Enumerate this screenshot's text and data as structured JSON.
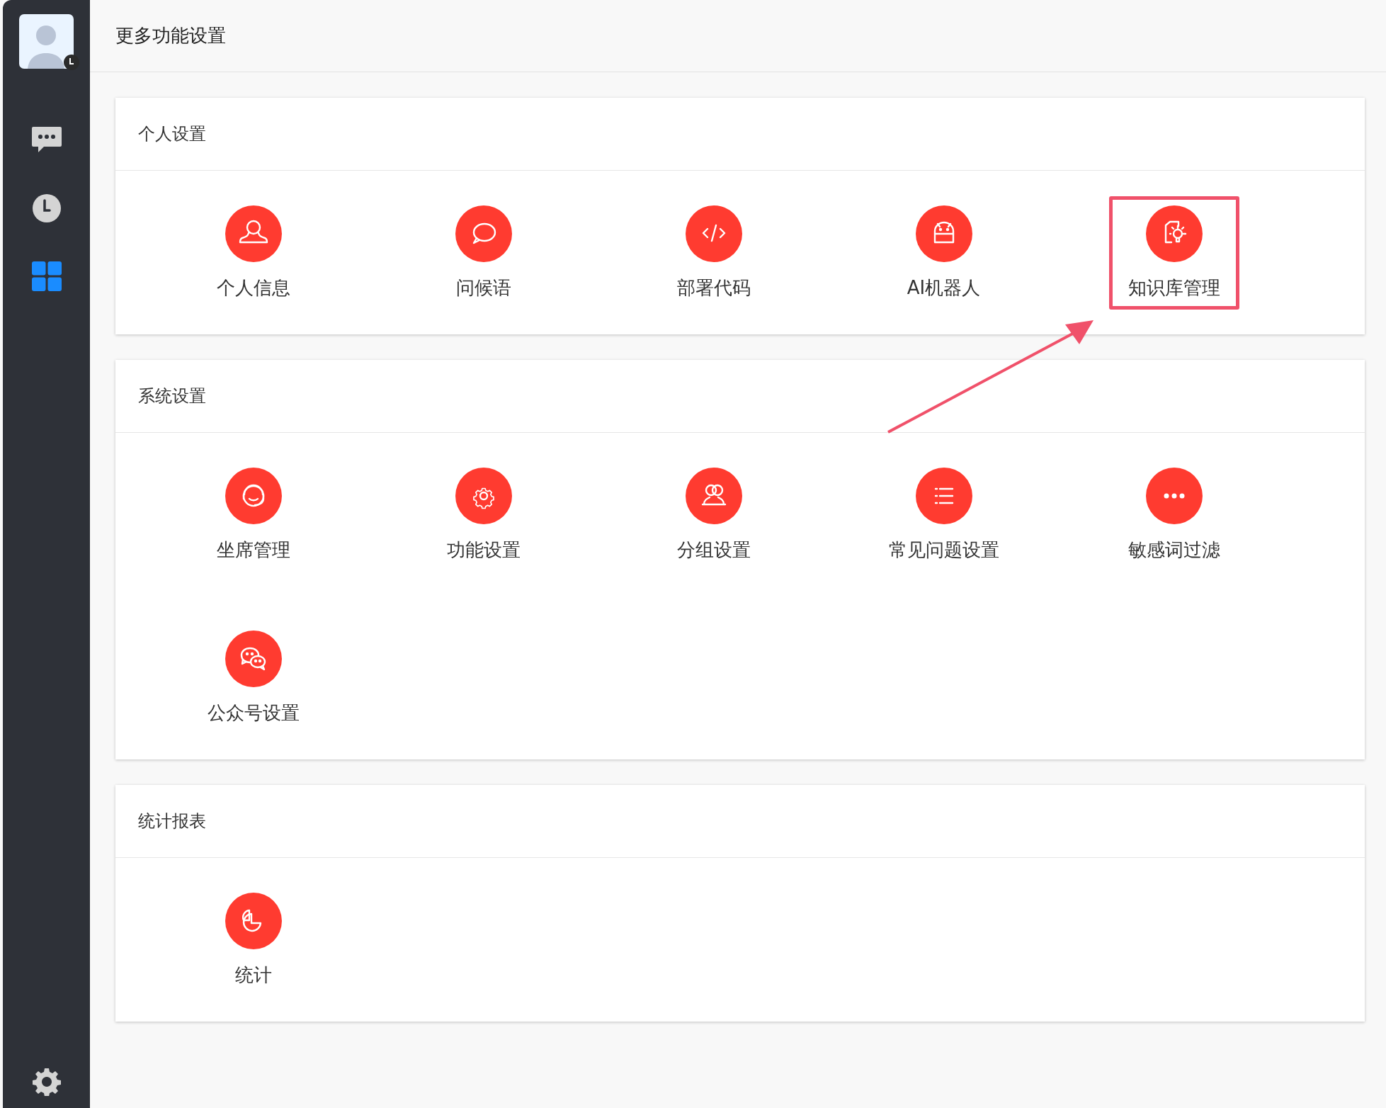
{
  "sidebar": {
    "items": [
      {
        "selected": false
      },
      {
        "selected": false
      },
      {
        "selected": true
      }
    ]
  },
  "header": {
    "title": "更多功能设置"
  },
  "sections": [
    {
      "title": "个人设置",
      "items": [
        {
          "label": "个人信息",
          "highlighted": false
        },
        {
          "label": "问候语",
          "highlighted": false
        },
        {
          "label": "部署代码",
          "highlighted": false
        },
        {
          "label": "AI机器人",
          "highlighted": false
        },
        {
          "label": "知识库管理",
          "highlighted": true
        }
      ]
    },
    {
      "title": "系统设置",
      "items": [
        {
          "label": "坐席管理",
          "highlighted": false
        },
        {
          "label": "功能设置",
          "highlighted": false
        },
        {
          "label": "分组设置",
          "highlighted": false
        },
        {
          "label": "常见问题设置",
          "highlighted": false
        },
        {
          "label": "敏感词过滤",
          "highlighted": false
        },
        {
          "label": "公众号设置",
          "highlighted": false
        }
      ]
    },
    {
      "title": "统计报表",
      "items": [
        {
          "label": "统计",
          "highlighted": false
        }
      ]
    }
  ]
}
